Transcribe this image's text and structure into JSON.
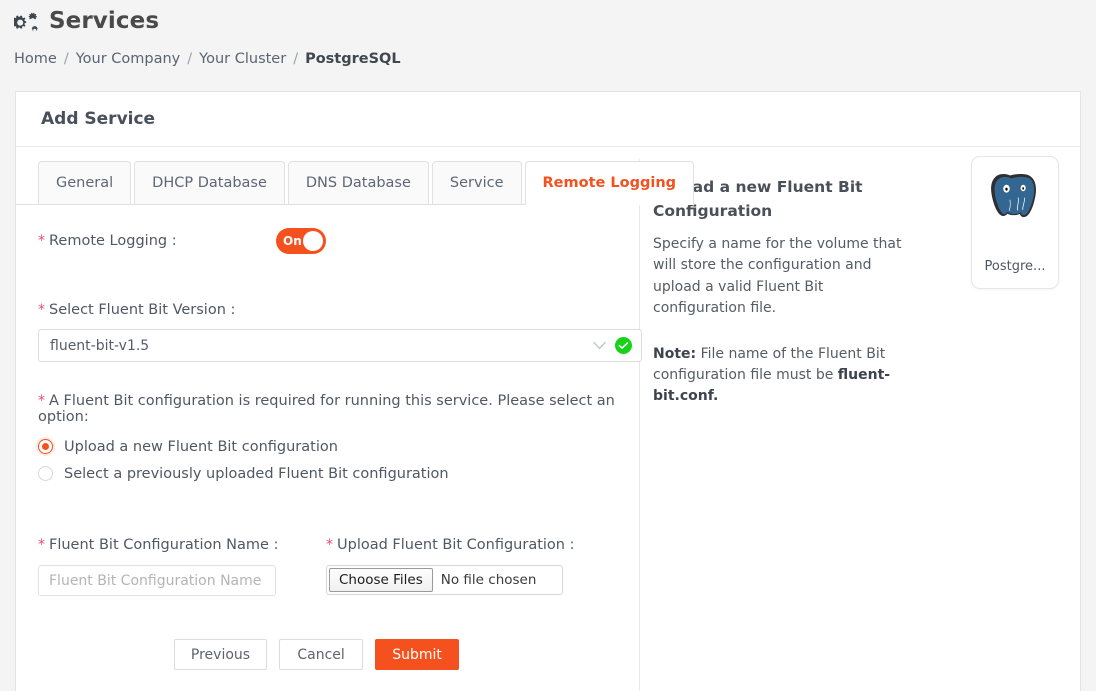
{
  "header": {
    "icon": "cogs-icon",
    "title": "Services",
    "breadcrumb": [
      {
        "label": "Home",
        "current": false
      },
      {
        "label": "Your Company",
        "current": false
      },
      {
        "label": "Your Cluster",
        "current": false
      },
      {
        "label": "PostgreSQL",
        "current": true
      }
    ],
    "breadcrumb_separator": "/"
  },
  "card": {
    "title": "Add Service"
  },
  "tabs": [
    {
      "label": "General",
      "active": false
    },
    {
      "label": "DHCP Database",
      "active": false
    },
    {
      "label": "DNS Database",
      "active": false
    },
    {
      "label": "Service",
      "active": false
    },
    {
      "label": "Remote Logging",
      "active": true
    }
  ],
  "form": {
    "required_marker": "*",
    "remote_logging": {
      "label": "Remote Logging :",
      "toggle_state": "On",
      "toggle_color": "#f4511e"
    },
    "fluent_bit_version": {
      "label": "Select Fluent Bit Version :",
      "value": "fluent-bit-v1.5",
      "chevron": "chevron-down-icon",
      "validation": "valid-check-icon",
      "valid_color": "#18d219"
    },
    "config_option": {
      "label": "A Fluent Bit configuration is required for running this service. Please select an option:",
      "options": [
        {
          "label": "Upload a new Fluent Bit configuration",
          "checked": true
        },
        {
          "label": "Select a previously uploaded Fluent Bit configuration",
          "checked": false
        }
      ]
    },
    "config_name": {
      "label": "Fluent Bit Configuration Name :",
      "value": "",
      "placeholder": "Fluent Bit Configuration Name"
    },
    "upload_config": {
      "label": "Upload Fluent Bit Configuration :",
      "button_label": "Choose Files",
      "file_status": "No file chosen"
    },
    "buttons": {
      "previous": "Previous",
      "cancel": "Cancel",
      "submit": "Submit"
    }
  },
  "help": {
    "title": "Upload a new Fluent Bit Configuration",
    "body": "Specify a name for the volume that will store the configuration and upload a valid Fluent Bit configuration file.",
    "note_prefix": "Note:",
    "note_text": " File name of the Fluent Bit configuration file must be ",
    "note_filename": "fluent-bit.conf.",
    "logo_card": {
      "icon": "postgresql-logo-icon",
      "wordmark": "PostgreSQL",
      "caption": "Postgre..."
    }
  },
  "colors": {
    "accent": "#f4511e",
    "required": "#e8506b",
    "success": "#18d219",
    "page_bg": "#f4f4f4"
  }
}
